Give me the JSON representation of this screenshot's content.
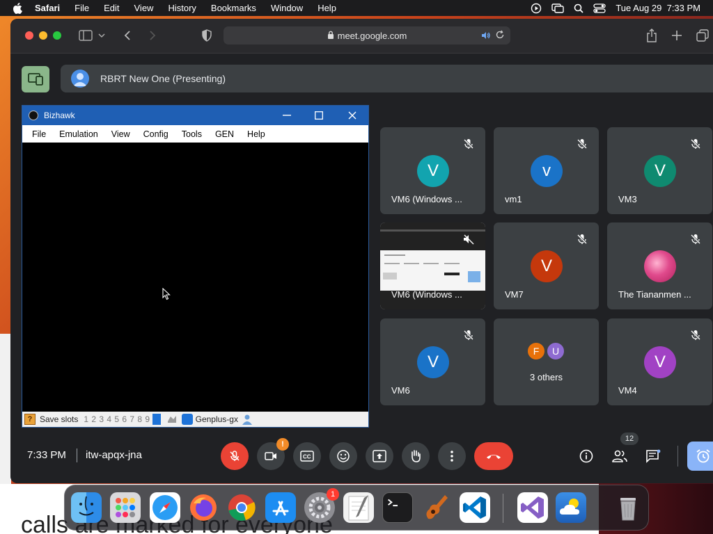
{
  "menubar": {
    "app_name": "Safari",
    "items": [
      "File",
      "Edit",
      "View",
      "History",
      "Bookmarks",
      "Window",
      "Help"
    ],
    "clock": "Tue Aug 29  7:33 PM"
  },
  "safari": {
    "url": "meet.google.com"
  },
  "meet": {
    "presenting_title": "RBRT New One (Presenting)",
    "time": "7:33 PM",
    "meeting_code": "itw-apqx-jna",
    "participant_count": "12",
    "camera_warning": "!",
    "participants": [
      {
        "name": "VM6 (Windows ...",
        "initial": "V",
        "color": "#12a4af"
      },
      {
        "name": "vm1",
        "initial": "v",
        "color": "#1a73c8"
      },
      {
        "name": "VM3",
        "initial": "V",
        "color": "#0f8a70"
      },
      {
        "name": "VM6 (Windows ...",
        "initial": "",
        "color": ""
      },
      {
        "name": "VM7",
        "initial": "V",
        "color": "#c5380c"
      },
      {
        "name": "The Tiananmen ...",
        "initial": "",
        "color": "#e04a8c"
      },
      {
        "name": "VM6",
        "initial": "V",
        "color": "#1a73c8"
      },
      {
        "name": "3 others",
        "initial": "",
        "color": ""
      },
      {
        "name": "VM4",
        "initial": "V",
        "color": "#a142c4"
      }
    ],
    "others": {
      "a": "F",
      "a_color": "#e8710a",
      "b": "U",
      "b_color": "#8e6bd1"
    }
  },
  "bizhawk": {
    "title": "Bizhawk",
    "menu": [
      "File",
      "Emulation",
      "View",
      "Config",
      "Tools",
      "GEN",
      "Help"
    ],
    "status": {
      "save_slots_label": "Save slots",
      "slots": "1 2 3 4 5 6 7 8 9",
      "core": "Genplus-gx",
      "q_icon": "?"
    }
  },
  "bg_page": {
    "text": "calls are marked for everyone"
  },
  "dock": {
    "apps": [
      "finder",
      "launchpad",
      "safari",
      "firefox",
      "chrome",
      "app-store",
      "system-settings",
      "textedit",
      "terminal",
      "garageband",
      "vscode",
      "visual-studio",
      "weather",
      "trash"
    ],
    "settings_badge": "1"
  }
}
